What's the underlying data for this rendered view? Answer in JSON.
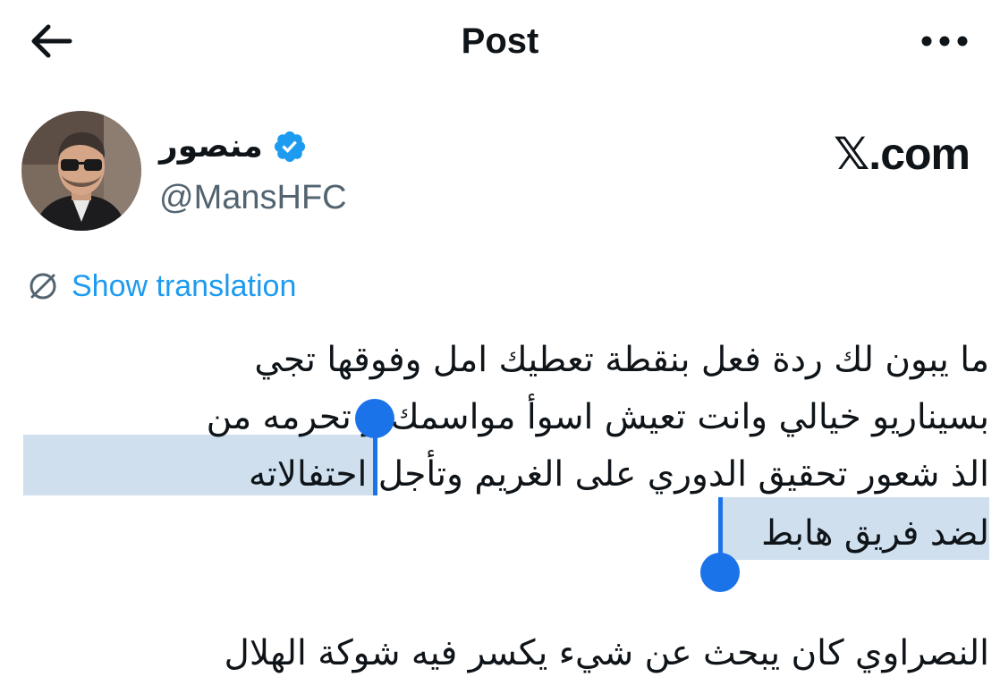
{
  "header": {
    "back_icon": "arrow-left-icon",
    "title": "Post",
    "more_icon": "more-horizontal-icon"
  },
  "author": {
    "display_name": "منصور",
    "verified_icon": "verified-badge-icon",
    "handle": "@MansHFC",
    "avatar": "avatar-photo"
  },
  "watermark": {
    "label": "𝕏.com"
  },
  "translation": {
    "icon": "translate-icon",
    "label": "Show translation"
  },
  "post": {
    "lines": [
      "ما يبون لك ردة فعل بنقطة تعطيك امل وفوقها تجي",
      "بسيناريو خيالي وانت تعيش اسوأ مواسمك و تحرمه من",
      "الذ شعور تحقيق الدوري على الغريم وتأجل احتفالاته",
      "لضد فريق هابط",
      "النصراوي كان يبحث عن شيء يكسر فيه شوكة الهلال"
    ]
  },
  "colors": {
    "accent": "#1d9bf0",
    "verified": "#1d9bf0",
    "selection": "#cfdfee",
    "selection_handle": "#1a73e8",
    "text": "#0f1419",
    "secondary": "#536471"
  }
}
